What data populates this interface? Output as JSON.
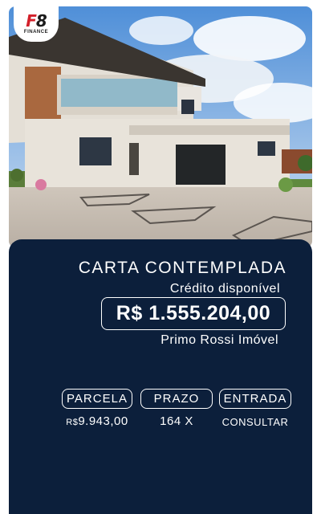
{
  "brand": {
    "logo_mark": "F8",
    "logo_sub": "FINANCE"
  },
  "card": {
    "title": "CARTA CONTEMPLADA",
    "subtitle": "Crédito disponível",
    "credit_value": "R$ 1.555.204,00",
    "description": "Primo Rossi Imóvel"
  },
  "terms": [
    {
      "label": "PARCELA",
      "currency": "R$",
      "value": "9.943,00"
    },
    {
      "label": "PRAZO",
      "value": "164 X"
    },
    {
      "label": "ENTRADA",
      "value": "CONSULTAR"
    }
  ],
  "colors": {
    "card_background": "#0c1f3b",
    "text": "#ffffff",
    "logo_accent": "#d3202a"
  }
}
